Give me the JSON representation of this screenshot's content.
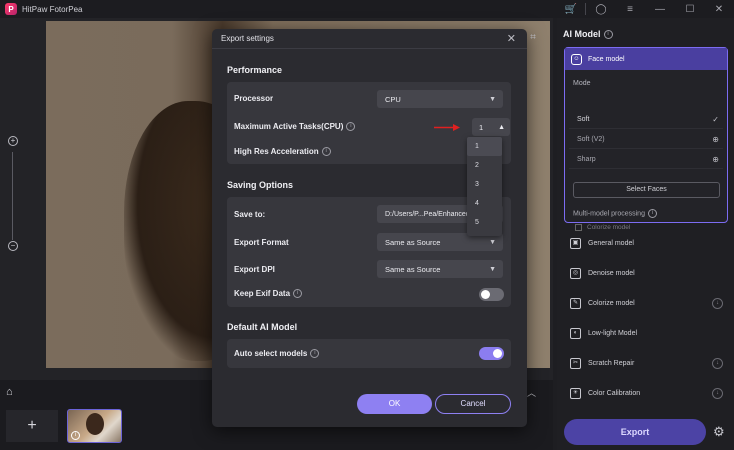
{
  "app": {
    "title": "HitPaw FotorPea",
    "logo_letter": "P"
  },
  "titlebar_icons": [
    "cart-icon",
    "user-icon",
    "menu-icon",
    "minimize-icon",
    "maximize-icon",
    "close-icon"
  ],
  "right_panel": {
    "title": "AI Model",
    "face_model": {
      "label": "Face model",
      "mode_label": "Mode",
      "modes": [
        {
          "label": "Soft",
          "state": "selected"
        },
        {
          "label": "Soft (V2)",
          "state": "download"
        },
        {
          "label": "Sharp",
          "state": "download"
        }
      ],
      "select_faces": "Select Faces",
      "multi_model": "Multi-model processing",
      "colorize_model": "Colorize model"
    },
    "models": [
      {
        "label": "General model",
        "download": false
      },
      {
        "label": "Denoise model",
        "download": false
      },
      {
        "label": "Colorize model",
        "download": true
      },
      {
        "label": "Low-light Model",
        "download": false
      },
      {
        "label": "Scratch Repair",
        "download": true
      },
      {
        "label": "Color Calibration",
        "download": true
      }
    ],
    "export_label": "Export"
  },
  "dialog": {
    "title": "Export settings",
    "performance": {
      "title": "Performance",
      "processor_label": "Processor",
      "processor_value": "CPU",
      "max_tasks_label": "Maximum Active Tasks(CPU)",
      "max_tasks_value": "1",
      "max_tasks_options": [
        "1",
        "2",
        "3",
        "4",
        "5"
      ],
      "high_res_label": "High Res Acceleration"
    },
    "saving": {
      "title": "Saving Options",
      "save_to_label": "Save to:",
      "save_to_value": "D:/Users/P...Pea/Enhanced",
      "export_format_label": "Export Format",
      "export_format_value": "Same as Source",
      "export_dpi_label": "Export DPI",
      "export_dpi_value": "Same as Source",
      "keep_exif_label": "Keep Exif Data",
      "keep_exif_on": false
    },
    "default_ai": {
      "title": "Default AI Model",
      "auto_select_label": "Auto select models",
      "auto_select_on": true
    },
    "ok_label": "OK",
    "cancel_label": "Cancel"
  },
  "colors": {
    "accent": "#8e80f2",
    "annotation_arrow": "#e02020"
  }
}
